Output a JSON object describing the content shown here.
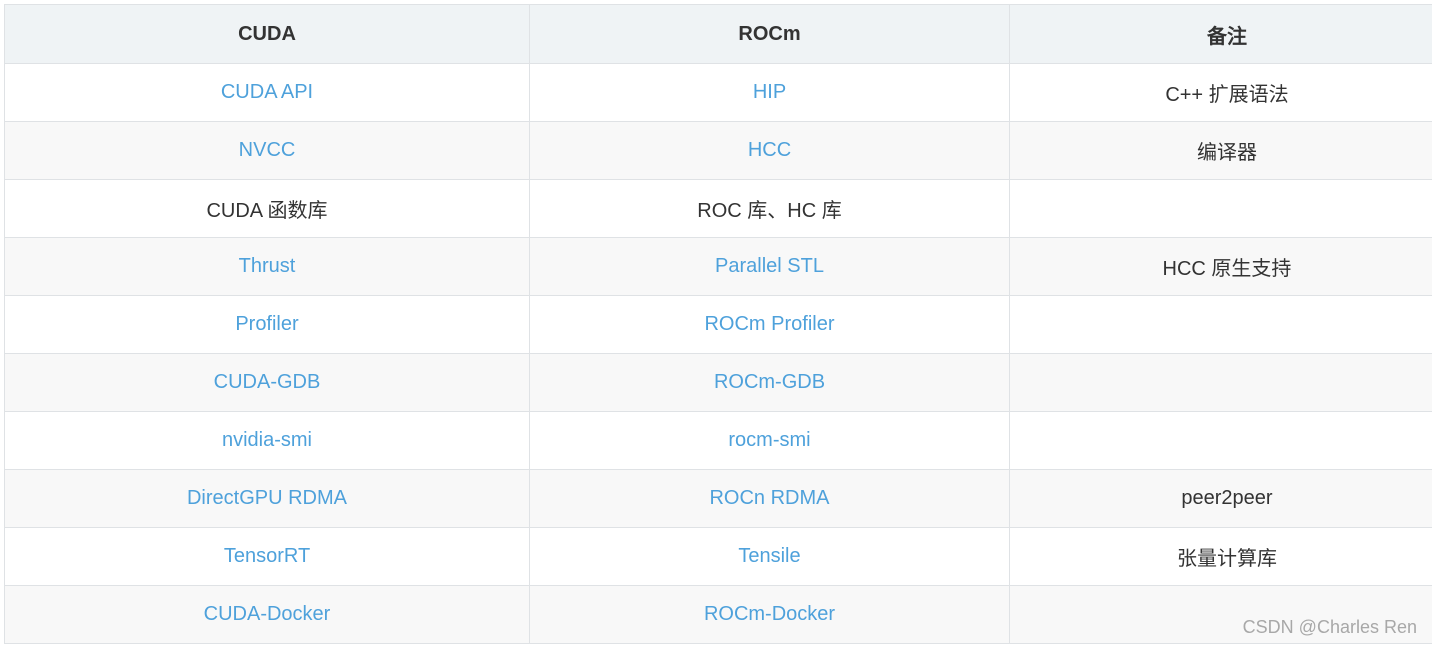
{
  "table": {
    "headers": [
      "CUDA",
      "ROCm",
      "备注"
    ],
    "rows": [
      [
        {
          "text": "CUDA API",
          "link": true
        },
        {
          "text": "HIP",
          "link": true
        },
        {
          "text": "C++ 扩展语法",
          "link": false
        }
      ],
      [
        {
          "text": "NVCC",
          "link": true
        },
        {
          "text": "HCC",
          "link": true
        },
        {
          "text": "编译器",
          "link": false
        }
      ],
      [
        {
          "text": "CUDA 函数库",
          "link": false
        },
        {
          "text": "ROC 库、HC 库",
          "link": false
        },
        {
          "text": "",
          "link": false
        }
      ],
      [
        {
          "text": "Thrust",
          "link": true
        },
        {
          "text": "Parallel STL",
          "link": true
        },
        {
          "text": "HCC 原生支持",
          "link": false
        }
      ],
      [
        {
          "text": "Profiler",
          "link": true
        },
        {
          "text": "ROCm Profiler",
          "link": true
        },
        {
          "text": "",
          "link": false
        }
      ],
      [
        {
          "text": "CUDA-GDB",
          "link": true
        },
        {
          "text": "ROCm-GDB",
          "link": true
        },
        {
          "text": "",
          "link": false
        }
      ],
      [
        {
          "text": "nvidia-smi",
          "link": true
        },
        {
          "text": "rocm-smi",
          "link": true
        },
        {
          "text": "",
          "link": false
        }
      ],
      [
        {
          "text": "DirectGPU RDMA",
          "link": true
        },
        {
          "text": "ROCn RDMA",
          "link": true
        },
        {
          "text": "peer2peer",
          "link": false
        }
      ],
      [
        {
          "text": "TensorRT",
          "link": true
        },
        {
          "text": "Tensile",
          "link": true
        },
        {
          "text": "张量计算库",
          "link": false
        }
      ],
      [
        {
          "text": "CUDA-Docker",
          "link": true
        },
        {
          "text": "ROCm-Docker",
          "link": true
        },
        {
          "text": "",
          "link": false
        }
      ]
    ]
  },
  "watermark": "CSDN @Charles Ren",
  "colors": {
    "link": "#4ea1db",
    "text": "#333333",
    "header_bg": "#eff3f5",
    "row_alt_bg": "#f8f8f8",
    "border": "#dfe2e5"
  }
}
